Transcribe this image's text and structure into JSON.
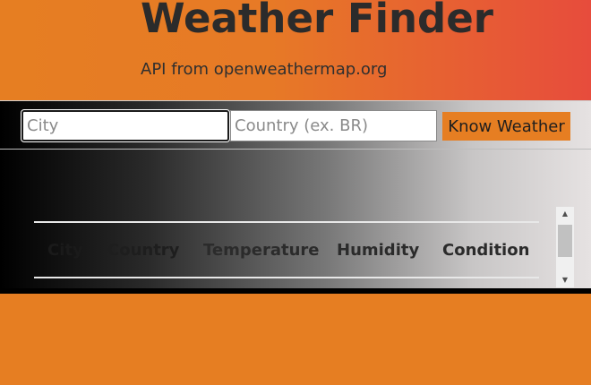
{
  "header": {
    "title": "Weather Finder",
    "subtitle": "API from openweathermap.org"
  },
  "form": {
    "city_placeholder": "City",
    "country_placeholder": "Country (ex. BR)",
    "submit_label": "Know Weather"
  },
  "table": {
    "headers": [
      "City",
      "Country",
      "Temperature",
      "Humidity",
      "Condition"
    ]
  },
  "scrollbar": {
    "up_icon": "▲",
    "down_icon": "▼"
  },
  "colors": {
    "accent": "#e67e22",
    "header_gradient_end": "#e74c3c"
  }
}
